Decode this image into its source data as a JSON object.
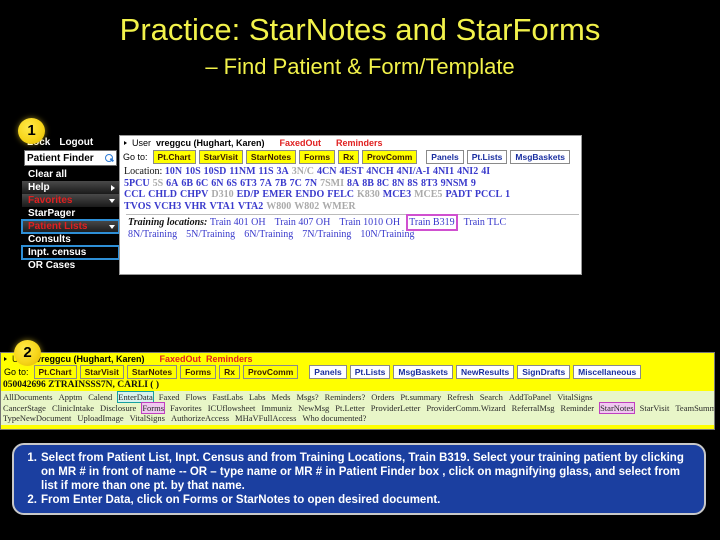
{
  "slide": {
    "title": "Practice: StarNotes and StarForms",
    "subtitle": "– Find Patient & Form/Template"
  },
  "badges": {
    "one": "1",
    "two": "2"
  },
  "screenshot1": {
    "sidebar": {
      "lock": "Lock",
      "logout": "Logout",
      "patient_finder_value": "Patient Finder",
      "search_icon": "magnifying-glass-icon",
      "items": [
        {
          "label": "Clear all",
          "style": "plain",
          "arrow": "none",
          "highlight": "none"
        },
        {
          "label": "Help",
          "style": "grad",
          "arrow": "right",
          "highlight": "none"
        },
        {
          "label": "Favorites",
          "style": "grad-red",
          "arrow": "down",
          "highlight": "none"
        },
        {
          "label": "StarPager",
          "style": "plain",
          "arrow": "none",
          "highlight": "none"
        },
        {
          "label": "Patient Lists",
          "style": "grad-red",
          "arrow": "down",
          "highlight": "teal"
        },
        {
          "label": "Consults",
          "style": "plain",
          "arrow": "none",
          "highlight": "none"
        },
        {
          "label": "Inpt. census",
          "style": "plain",
          "arrow": "none",
          "highlight": "teal"
        },
        {
          "label": "OR Cases",
          "style": "plain",
          "arrow": "none",
          "highlight": "none"
        }
      ]
    },
    "userbar": {
      "user_label": "User",
      "user_id": "vreggcu (Hughart, Karen)",
      "alert1": "FaxedOut",
      "alert2": "Reminders"
    },
    "goto": {
      "label": "Go to:",
      "yellow_buttons": [
        "Pt.Chart",
        "StarVisit",
        "StarNotes",
        "Forms",
        "Rx",
        "ProvComm"
      ],
      "blue_buttons": [
        "Panels",
        "Pt.Lists",
        "MsgBaskets"
      ]
    },
    "locations": {
      "label": "Location:",
      "rows": [
        [
          {
            "t": "10N",
            "on": true
          },
          {
            "t": "10S",
            "on": true
          },
          {
            "t": "10SD",
            "on": true
          },
          {
            "t": "11NM",
            "on": true
          },
          {
            "t": "11S",
            "on": true
          },
          {
            "t": "3A",
            "on": true
          },
          {
            "t": "3N/C",
            "on": false
          },
          {
            "t": "4CN",
            "on": true
          },
          {
            "t": "4EST",
            "on": true
          },
          {
            "t": "4NCH",
            "on": true
          },
          {
            "t": "4NI/A-I",
            "on": true
          },
          {
            "t": "4NI1",
            "on": true
          },
          {
            "t": "4NI2",
            "on": true
          },
          {
            "t": "4I",
            "on": true
          }
        ],
        [
          {
            "t": "5PCU",
            "on": true
          },
          {
            "t": "5S",
            "on": false
          },
          {
            "t": "6A",
            "on": true
          },
          {
            "t": "6B",
            "on": true
          },
          {
            "t": "6C",
            "on": true
          },
          {
            "t": "6N",
            "on": true
          },
          {
            "t": "6S",
            "on": true
          },
          {
            "t": "6T3",
            "on": true
          },
          {
            "t": "7A",
            "on": true
          },
          {
            "t": "7B",
            "on": true
          },
          {
            "t": "7C",
            "on": true
          },
          {
            "t": "7N",
            "on": true
          },
          {
            "t": "7SMI",
            "on": false
          },
          {
            "t": "8A",
            "on": true
          },
          {
            "t": "8B",
            "on": true
          },
          {
            "t": "8C",
            "on": true
          },
          {
            "t": "8N",
            "on": true
          },
          {
            "t": "8S",
            "on": true
          },
          {
            "t": "8T3",
            "on": true
          },
          {
            "t": "9NSM",
            "on": true
          },
          {
            "t": "9",
            "on": true
          }
        ],
        [
          {
            "t": "CCL",
            "on": true
          },
          {
            "t": "CHLD",
            "on": true
          },
          {
            "t": "CHPV",
            "on": true
          },
          {
            "t": "D310",
            "on": false
          },
          {
            "t": "ED/P",
            "on": true
          },
          {
            "t": "EMER",
            "on": true
          },
          {
            "t": "ENDO",
            "on": true
          },
          {
            "t": "FELC",
            "on": true
          },
          {
            "t": "K830",
            "on": false
          },
          {
            "t": "MCE3",
            "on": true
          },
          {
            "t": "MCE5",
            "on": false
          },
          {
            "t": "PADT",
            "on": true
          },
          {
            "t": "PCCL",
            "on": true
          },
          {
            "t": "1",
            "on": true
          }
        ],
        [
          {
            "t": "TVOS",
            "on": true
          },
          {
            "t": "VCH3",
            "on": true
          },
          {
            "t": "VHR",
            "on": true
          },
          {
            "t": "VTA1",
            "on": true
          },
          {
            "t": "VTA2",
            "on": true
          },
          {
            "t": "W800",
            "on": false
          },
          {
            "t": "W802",
            "on": false
          },
          {
            "t": "WMER",
            "on": false
          }
        ]
      ]
    },
    "training": {
      "label": "Training locations:",
      "row1": [
        "Train 401 OH",
        "Train 407 OH",
        "Train 1010 OH",
        "Train B319",
        "Train TLC"
      ],
      "row1_highlight": "Train B319",
      "row2": [
        "8N/Training",
        "5N/Training",
        "6N/Training",
        "7N/Training",
        "10N/Training"
      ]
    }
  },
  "screenshot2": {
    "userbar": {
      "user_label": "User",
      "user_id": "vreggcu (Hughart, Karen)",
      "alert1": "FaxedOut",
      "alert2": "Reminders"
    },
    "goto": {
      "label": "Go to:",
      "yellow_buttons": [
        "Pt.Chart",
        "StarVisit",
        "StarNotes",
        "Forms",
        "Rx",
        "ProvComm"
      ],
      "blue_buttons": [
        "Panels",
        "Pt.Lists",
        "MsgBaskets",
        "NewResults",
        "SignDrafts",
        "Miscellaneous"
      ]
    },
    "patient_line": "050042696   ZTRAINSSS7N, CARLI  ( )",
    "menu_rows": [
      [
        {
          "t": "AllDocuments",
          "hl": "none"
        },
        {
          "t": "Apptm",
          "hl": "none"
        },
        {
          "t": "Calend",
          "hl": "none"
        },
        {
          "t": "EnterData",
          "hl": "teal"
        },
        {
          "t": "Faxed",
          "hl": "none"
        },
        {
          "t": "Flows",
          "hl": "none"
        },
        {
          "t": "FastLabs",
          "hl": "none"
        },
        {
          "t": "Labs",
          "hl": "none"
        },
        {
          "t": "Meds",
          "hl": "none"
        },
        {
          "t": "Msgs?",
          "hl": "none"
        },
        {
          "t": "Reminders?",
          "hl": "none"
        },
        {
          "t": "Orders",
          "hl": "none"
        },
        {
          "t": "Pt.summary",
          "hl": "none"
        },
        {
          "t": "Refresh",
          "hl": "none"
        },
        {
          "t": "Search",
          "hl": "none"
        },
        {
          "t": "AddToPanel",
          "hl": "none"
        },
        {
          "t": "VitalSigns",
          "hl": "none"
        }
      ],
      [
        {
          "t": "CancerStage",
          "hl": "none"
        },
        {
          "t": "ClinicIntake",
          "hl": "none"
        },
        {
          "t": "Disclosure",
          "hl": "none"
        },
        {
          "t": "Forms",
          "hl": "mag"
        },
        {
          "t": "Favorites",
          "hl": "none"
        },
        {
          "t": "ICUflowsheet",
          "hl": "none"
        },
        {
          "t": "Immuniz",
          "hl": "none"
        },
        {
          "t": "NewMsg",
          "hl": "none"
        },
        {
          "t": "Pt.Letter",
          "hl": "none"
        },
        {
          "t": "ProviderLetter",
          "hl": "none"
        },
        {
          "t": "ProviderComm.Wizard",
          "hl": "none"
        },
        {
          "t": "ReferralMsg",
          "hl": "none"
        },
        {
          "t": "Reminder",
          "hl": "none"
        },
        {
          "t": "StarNotes",
          "hl": "mag"
        },
        {
          "t": "StarVisit",
          "hl": "none"
        },
        {
          "t": "TeamSummary",
          "hl": "none"
        }
      ],
      [
        {
          "t": "TypeNewDocument",
          "hl": "none"
        },
        {
          "t": "UploadImage",
          "hl": "none"
        },
        {
          "t": "VitalSigns",
          "hl": "none"
        },
        {
          "t": "AuthorizeAccess",
          "hl": "none"
        },
        {
          "t": "MHaVFullAccess",
          "hl": "none"
        },
        {
          "t": "Who documented?",
          "hl": "none"
        }
      ]
    ]
  },
  "instructions": [
    {
      "num": "1.",
      "text": "Select from Patient List, Inpt. Census and from Training Locations, Train B319.  Select  your training patient by clicking on MR # in front of name  -- OR – type name or MR # in Patient Finder box , click on magnifying glass, and select from list if more than one pt. by that name."
    },
    {
      "num": "2.",
      "text": "From Enter Data, click on Forms or StarNotes to open desired document."
    }
  ],
  "colors": {
    "title_yellow": "#f2f24a",
    "instruction_blue": "#1b3fa0",
    "screen2_yellow": "#ffff00",
    "highlight_teal": "#16a0a0",
    "highlight_magenta": "#c040c0",
    "link_blue": "#3a3acc",
    "alert_red": "#e02020"
  }
}
